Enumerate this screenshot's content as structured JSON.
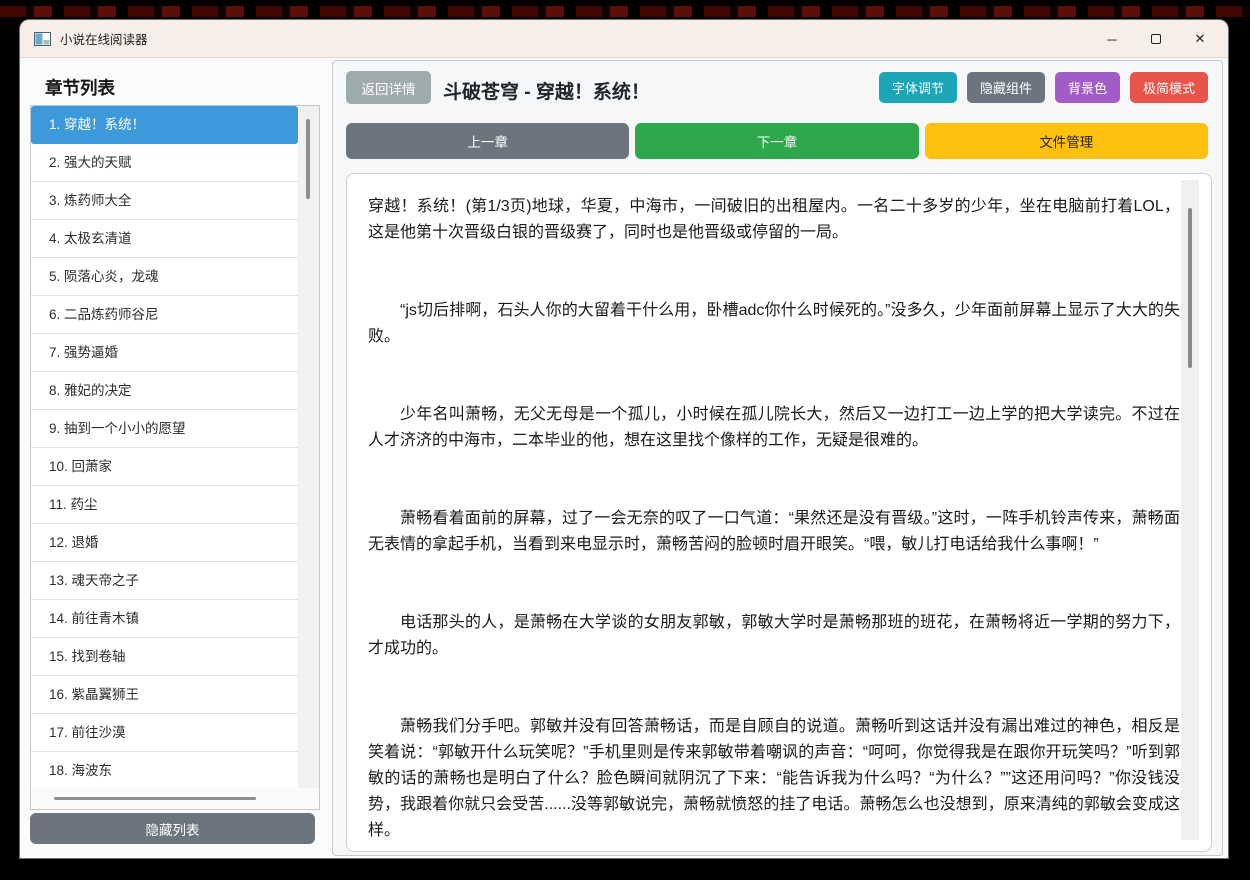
{
  "window": {
    "title": "小说在线阅读器",
    "controls": {
      "minimize": "─",
      "close": "✕"
    }
  },
  "sidebar": {
    "title": "章节列表",
    "selected_bg": "#3d99d9",
    "hide_list_button": "隐藏列表",
    "hide_list_color": "#6c757d",
    "chapters": [
      {
        "label": "1. 穿越！系统！",
        "selected": true
      },
      {
        "label": "2. 强大的天赋",
        "selected": false
      },
      {
        "label": "3. 炼药师大全",
        "selected": false
      },
      {
        "label": "4. 太极玄清道",
        "selected": false
      },
      {
        "label": "5. 陨落心炎，龙魂",
        "selected": false
      },
      {
        "label": "6. 二品炼药师谷尼",
        "selected": false
      },
      {
        "label": "7. 强势逼婚",
        "selected": false
      },
      {
        "label": "8. 雅妃的决定",
        "selected": false
      },
      {
        "label": "9. 抽到一个小小的愿望",
        "selected": false
      },
      {
        "label": "10. 回萧家",
        "selected": false
      },
      {
        "label": "11. 药尘",
        "selected": false
      },
      {
        "label": "12. 退婚",
        "selected": false
      },
      {
        "label": "13. 魂天帝之子",
        "selected": false
      },
      {
        "label": "14. 前往青木镇",
        "selected": false
      },
      {
        "label": "15. 找到卷轴",
        "selected": false
      },
      {
        "label": "16. 紫晶翼狮王",
        "selected": false
      },
      {
        "label": "17. 前往沙漠",
        "selected": false
      },
      {
        "label": "18. 海波东",
        "selected": false
      }
    ]
  },
  "header": {
    "back_button": "返回详情",
    "back_color": "#9eabab",
    "title": "斗破苍穹 - 穿越！系统！",
    "buttons": [
      {
        "label": "字体调节",
        "color": "#1ca7b8"
      },
      {
        "label": "隐藏组件",
        "color": "#6c757d"
      },
      {
        "label": "背景色",
        "color": "#a35bc7"
      },
      {
        "label": "极简模式",
        "color": "#e8544a"
      }
    ]
  },
  "nav": {
    "prev_label": "上一章",
    "prev_color": "#6c757d",
    "next_label": "下一章",
    "next_color": "#2da84c",
    "files_label": "文件管理",
    "files_color": "#ffc10d"
  },
  "reader": {
    "paragraphs": [
      "穿越！系统！(第1/3页)地球，华夏，中海市，一间破旧的出租屋内。一名二十多岁的少年，坐在电脑前打着LOL，这是他第十次晋级白银的晋级赛了，同时也是他晋级或停留的一局。",
      "“js切后排啊，石头人你的大留着干什么用，卧槽adc你什么时候死的。”没多久，少年面前屏幕上显示了大大的失败。",
      "少年名叫萧畅，无父无母是一个孤儿，小时候在孤儿院长大，然后又一边打工一边上学的把大学读完。不过在人才济济的中海市，二本毕业的他，想在这里找个像样的工作，无疑是很难的。",
      "萧畅看着面前的屏幕，过了一会无奈的叹了一口气道：“果然还是没有晋级。”这时，一阵手机铃声传来，萧畅面无表情的拿起手机，当看到来电显示时，萧畅苦闷的脸顿时眉开眼笑。“喂，敏儿打电话给我什么事啊！”",
      "电话那头的人，是萧畅在大学谈的女朋友郭敏，郭敏大学时是萧畅那班的班花，在萧畅将近一学期的努力下，才成功的。",
      "萧畅我们分手吧。郭敏并没有回答萧畅话，而是自顾自的说道。萧畅听到这话并没有漏出难过的神色，相反是笑着说：“郭敏开什么玩笑呢？”手机里则是传来郭敏带着嘲讽的声音：“呵呵，你觉得我是在跟你开玩笑吗？”听到郭敏的话的萧畅也是明白了什么？脸色瞬间就阴沉了下来：“能告诉我为什么吗？“为什么？””这还用问吗？”你没钱没势，我跟着你就只会受苦......没等郭敏说完，萧畅就愤怒的挂了电话。萧畅怎么也没想到，原来清纯的郭敏会变成这样。"
    ]
  }
}
